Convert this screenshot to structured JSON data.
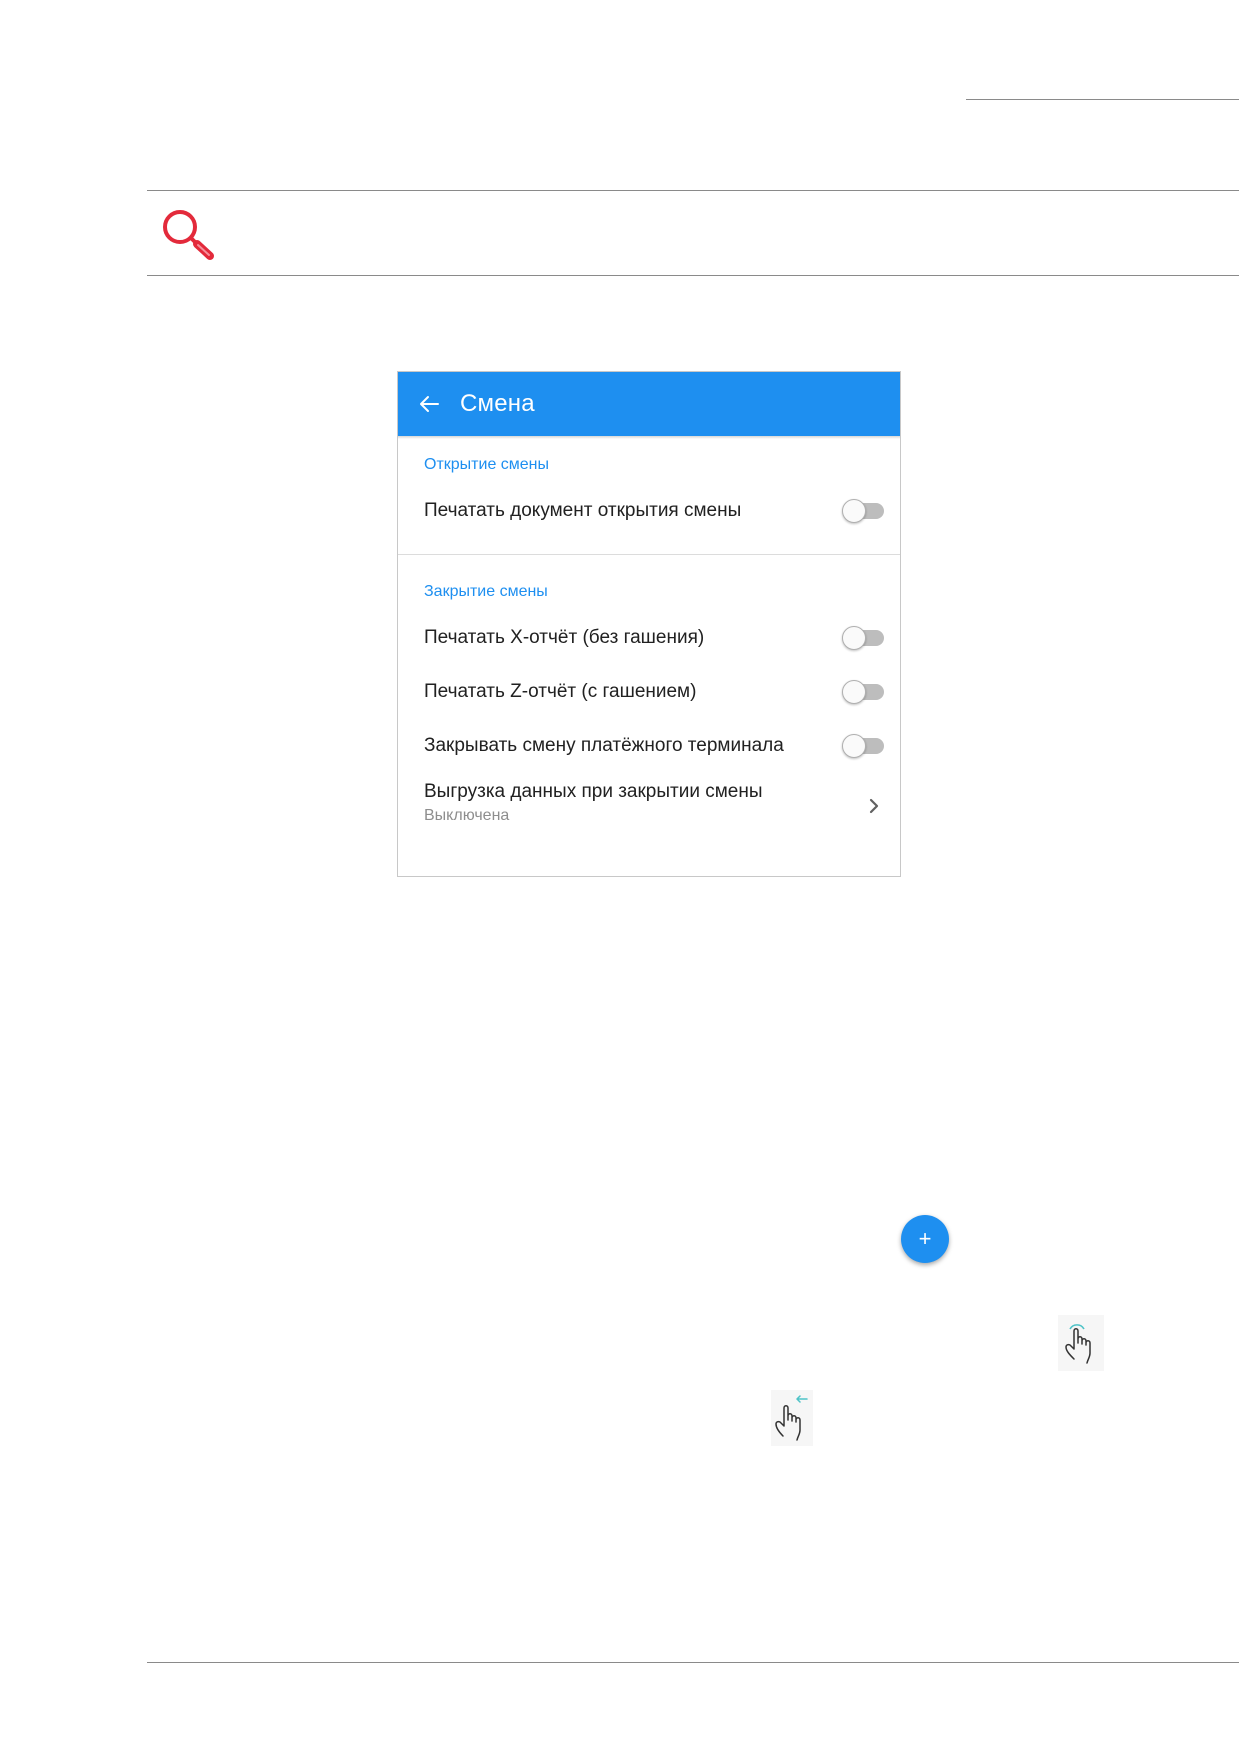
{
  "screen": {
    "title": "Смена",
    "colors": {
      "accent": "#1e8ff0",
      "toggle_off_track": "#bdbdbd",
      "secondary_text": "#8e8e8e"
    },
    "sections": [
      {
        "title": "Открытие смены",
        "toggles": [
          {
            "label": "Печатать документ открытия смены",
            "on": false
          }
        ]
      },
      {
        "title": "Закрытие смены",
        "toggles": [
          {
            "label": "Печатать X-отчёт (без гашения)",
            "on": false
          },
          {
            "label": "Печатать Z-отчёт (с гашением)",
            "on": false
          },
          {
            "label": "Закрывать смену платёжного терминала",
            "on": false
          }
        ],
        "nav_item": {
          "label": "Выгрузка данных при закрытии смены",
          "subtitle": "Выключена"
        }
      }
    ]
  },
  "fab": {
    "label": "+"
  },
  "icons": {
    "note": "magnifier-icon",
    "back": "arrow-left-icon",
    "chevron": "chevron-right-icon",
    "tap": "hand-tap-icon",
    "swipe": "hand-swipe-left-icon"
  }
}
